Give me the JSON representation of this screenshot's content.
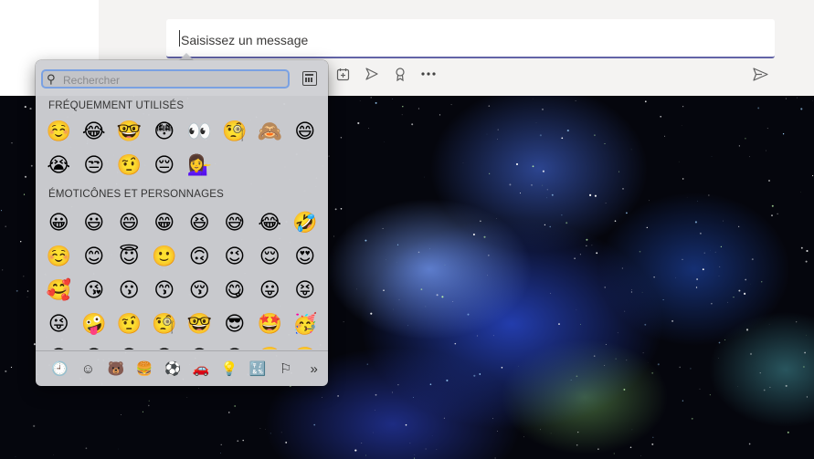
{
  "compose": {
    "placeholder": "Saisissez un message",
    "toolbar_icons": [
      "schedule-meeting-icon",
      "stream-icon",
      "praise-icon",
      "more-options-icon"
    ],
    "send_icon": "send-icon",
    "accent_color": "#6264a7"
  },
  "emoji_picker": {
    "search_placeholder": "Rechercher",
    "sections": [
      {
        "title": "FRÉQUEMMENT UTILISÉS",
        "emojis": [
          "☺️",
          "😂",
          "🤓",
          "😳",
          "👀",
          "🧐",
          "🙈",
          "😄",
          "😭",
          "😒",
          "🤨",
          "😔",
          "💁‍♀️"
        ]
      },
      {
        "title": "ÉMOTICÔNES ET PERSONNAGES",
        "emojis": [
          "😀",
          "😃",
          "😄",
          "😁",
          "😆",
          "😅",
          "😂",
          "🤣",
          "☺️",
          "😊",
          "😇",
          "🙂",
          "🙃",
          "😉",
          "😌",
          "😍",
          "🥰",
          "😘",
          "😗",
          "😙",
          "😚",
          "😋",
          "😛",
          "😝",
          "😜",
          "🤪",
          "🤨",
          "🧐",
          "🤓",
          "😎",
          "🤩",
          "🥳",
          "😏",
          "😒",
          "😞",
          "😔",
          "😟",
          "😕",
          "🙁",
          "☹️"
        ]
      }
    ],
    "tabs": [
      {
        "icon": "clock-icon",
        "glyph": "🕘",
        "active": true
      },
      {
        "icon": "smiley-icon",
        "glyph": "☺",
        "active": false
      },
      {
        "icon": "bear-icon",
        "glyph": "🐻",
        "active": false
      },
      {
        "icon": "food-icon",
        "glyph": "🍔",
        "active": false
      },
      {
        "icon": "ball-icon",
        "glyph": "⚽",
        "active": false
      },
      {
        "icon": "car-icon",
        "glyph": "🚗",
        "active": false
      },
      {
        "icon": "lightbulb-icon",
        "glyph": "💡",
        "active": false
      },
      {
        "icon": "symbols-icon",
        "glyph": "🔣",
        "active": false
      },
      {
        "icon": "flag-icon",
        "glyph": "⚐",
        "active": false
      },
      {
        "icon": "more-icon",
        "glyph": "»",
        "active": false
      }
    ]
  }
}
